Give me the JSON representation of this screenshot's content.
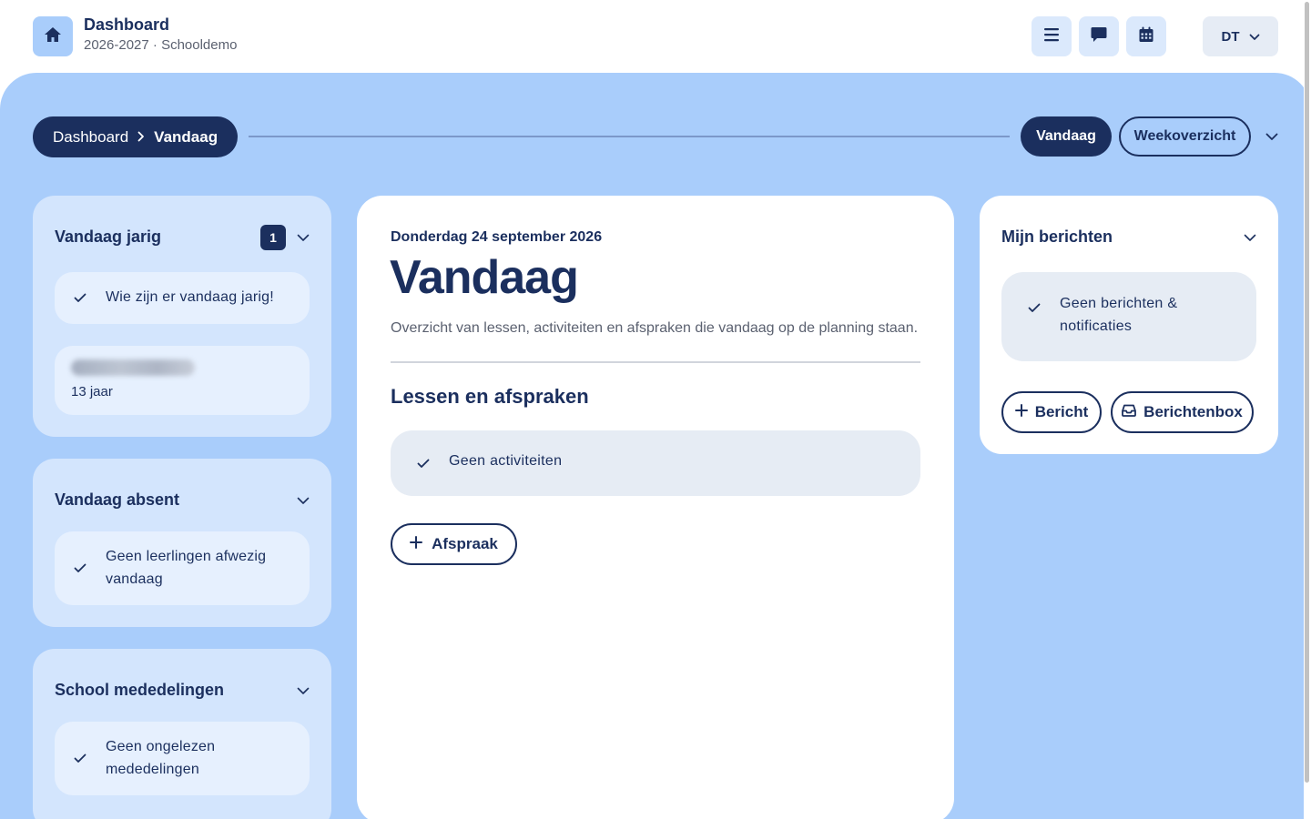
{
  "header": {
    "title": "Dashboard",
    "subtitle": "2026-2027 · Schooldemo",
    "user_initials": "DT",
    "icons": [
      "home-icon",
      "menu-icon",
      "chat-icon",
      "calendar-icon",
      "chevron-down-icon"
    ]
  },
  "breadcrumb": {
    "parent": "Dashboard",
    "current": "Vandaag"
  },
  "view_toggle": {
    "active": "Vandaag",
    "other": "Weekoverzicht"
  },
  "birthdays": {
    "title": "Vandaag jarig",
    "count": "1",
    "prompt": "Wie zijn er vandaag jarig!",
    "person_age": "13 jaar"
  },
  "absent": {
    "title": "Vandaag absent",
    "empty": "Geen leerlingen afwezig vandaag"
  },
  "announcements": {
    "title": "School mededelingen",
    "empty": "Geen ongelezen mededelingen"
  },
  "today": {
    "date": "Donderdag 24 september 2026",
    "title": "Vandaag",
    "description": "Overzicht van lessen, activiteiten en afspraken die vandaag op de planning staan.",
    "section_title": "Lessen en afspraken",
    "empty": "Geen activiteiten",
    "add_button": "Afspraak"
  },
  "messages": {
    "title": "Mijn berichten",
    "empty": "Geen berichten & notificaties",
    "new_button": "Bericht",
    "inbox_button": "Berichtenbox"
  },
  "colors": {
    "navy": "#1b2f5e",
    "background_blue": "#a9cdfb",
    "card_light_blue": "#d3e5fd",
    "empty_state_grey": "#e6ecf4"
  }
}
